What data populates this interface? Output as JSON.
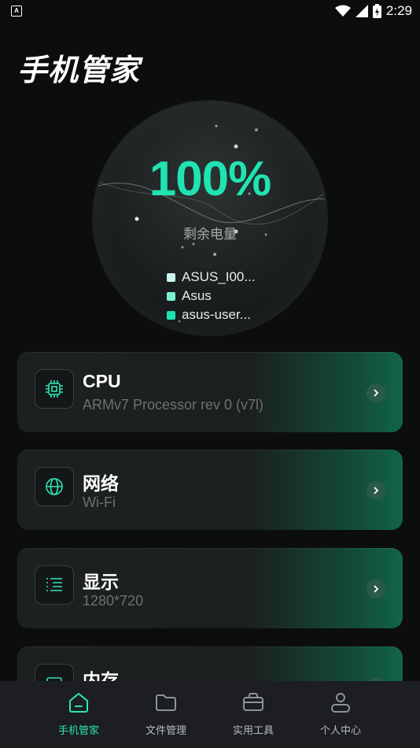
{
  "status_bar": {
    "left_icon": "A",
    "icons": [
      "wifi-icon",
      "signal-icon",
      "battery-charging-icon"
    ],
    "time": "2:29"
  },
  "app_title": "手机管家",
  "battery": {
    "percent": "100%",
    "label": "剩余电量",
    "level": 1.0,
    "accent_color": "#1fe3b2"
  },
  "device_info": [
    {
      "text": "ASUS_I00...",
      "color": "#c9f5ea"
    },
    {
      "text": "Asus",
      "color": "#7cf0d2"
    },
    {
      "text": "asus-user...",
      "color": "#1fe3b2"
    }
  ],
  "cards": [
    {
      "title": "CPU",
      "subtitle": "ARMv7 Processor rev 0 (v7l)",
      "icon": "cpu-chip-icon"
    },
    {
      "title": "网络",
      "subtitle": "Wi-Fi",
      "icon": "globe-icon"
    },
    {
      "title": "显示",
      "subtitle": "1280*720",
      "icon": "list-lines-icon"
    },
    {
      "title": "内存",
      "subtitle": "",
      "icon": "memory-icon"
    }
  ],
  "bottom_nav": [
    {
      "label": "手机管家",
      "icon": "home-icon",
      "active": true
    },
    {
      "label": "文件管理",
      "icon": "folder-icon",
      "active": false
    },
    {
      "label": "实用工具",
      "icon": "toolbox-icon",
      "active": false
    },
    {
      "label": "个人中心",
      "icon": "person-icon",
      "active": false
    }
  ]
}
